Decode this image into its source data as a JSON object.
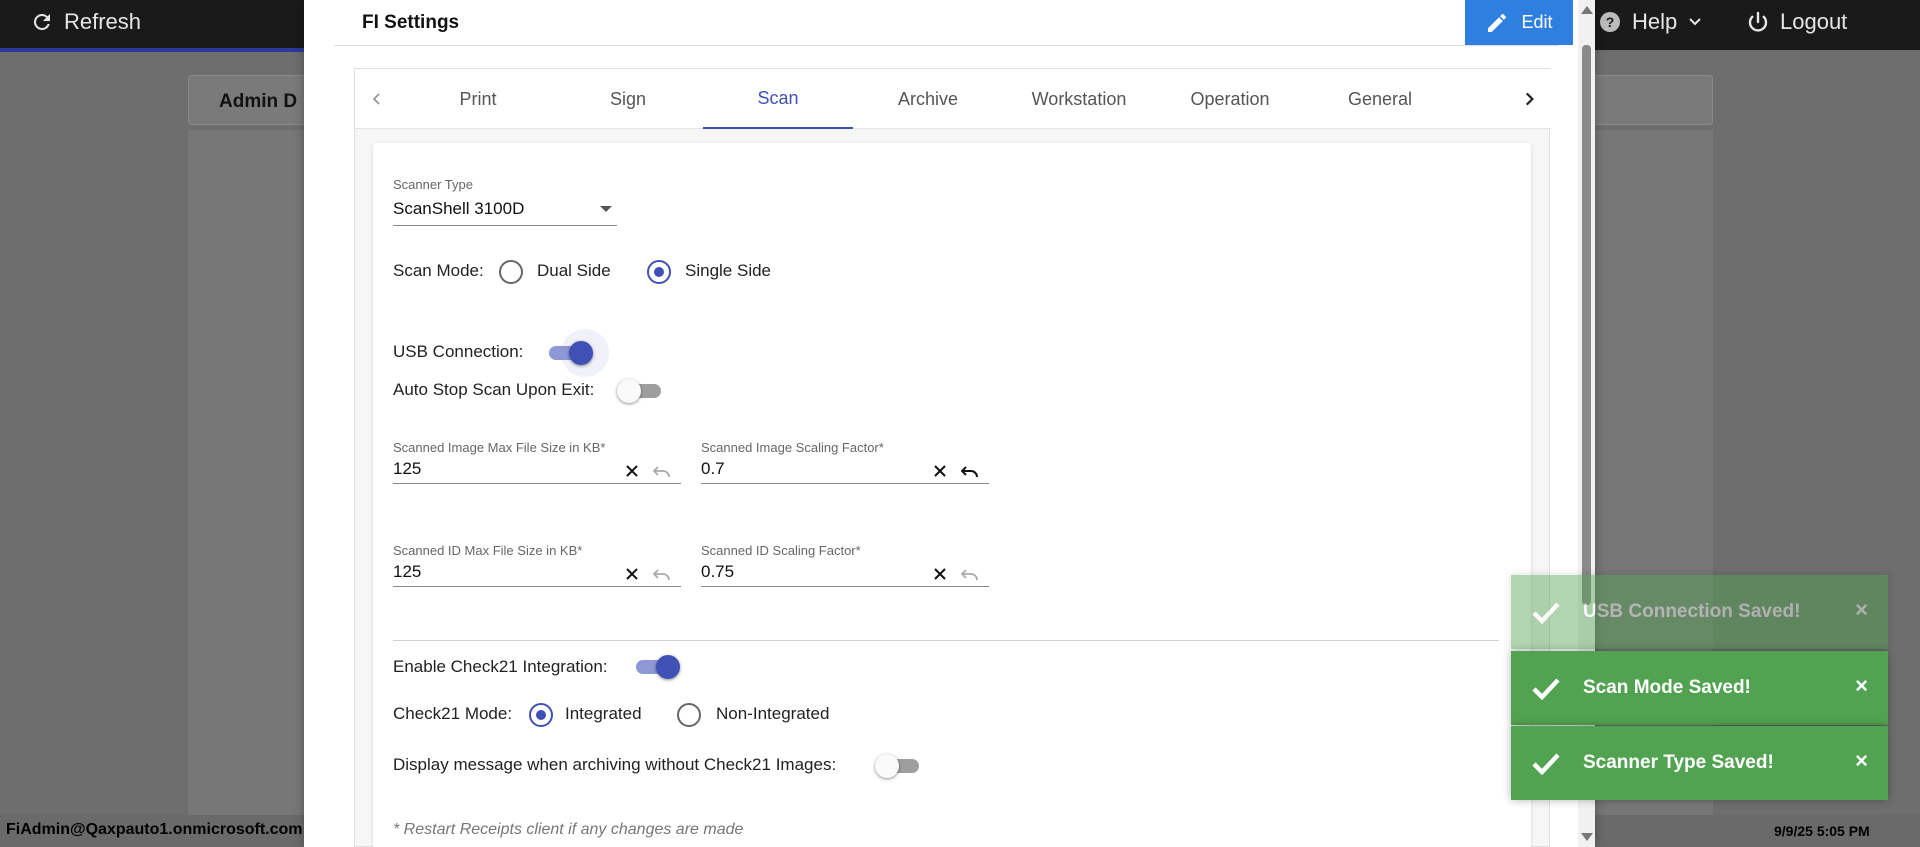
{
  "topbar": {
    "refresh_label": "Refresh",
    "help_label": "Help",
    "logout_label": "Logout"
  },
  "background": {
    "card_title": "Admin D",
    "user_email": "FiAdmin@Qaxpauto1.onmicrosoft.com",
    "datetime": "9/9/25 5:05 PM"
  },
  "modal": {
    "title": "FI Settings",
    "edit_label": "Edit",
    "tabs": [
      {
        "label": "Print"
      },
      {
        "label": "Sign"
      },
      {
        "label": "Scan"
      },
      {
        "label": "Archive"
      },
      {
        "label": "Workstation"
      },
      {
        "label": "Operation"
      },
      {
        "label": "General"
      }
    ],
    "active_tab": "Scan"
  },
  "scan": {
    "scanner_type_label": "Scanner Type",
    "scanner_type_value": "ScanShell 3100D",
    "scan_mode_label": "Scan Mode:",
    "scan_mode_options": [
      "Dual Side",
      "Single Side"
    ],
    "scan_mode_selected": "Single Side",
    "usb_label": "USB Connection:",
    "usb_on": true,
    "auto_stop_label": "Auto Stop Scan Upon Exit:",
    "auto_stop_on": false,
    "img_max_label": "Scanned Image Max File Size in KB*",
    "img_max_value": "125",
    "img_scale_label": "Scanned Image Scaling Factor*",
    "img_scale_value": "0.7",
    "id_max_label": "Scanned ID Max File Size in KB*",
    "id_max_value": "125",
    "id_scale_label": "Scanned ID Scaling Factor*",
    "id_scale_value": "0.75",
    "check21_label": "Enable Check21 Integration:",
    "check21_on": true,
    "check21_mode_label": "Check21 Mode:",
    "check21_mode_options": [
      "Integrated",
      "Non-Integrated"
    ],
    "check21_mode_selected": "Integrated",
    "archive_msg_label": "Display message when archiving without Check21 Images:",
    "archive_msg_on": false,
    "restart_note": "* Restart Receipts client if any changes are made"
  },
  "toasts": [
    {
      "message": "USB Connection Saved!",
      "close": "×"
    },
    {
      "message": "Scan Mode Saved!",
      "close": "×"
    },
    {
      "message": "Scanner Type Saved!",
      "close": "×"
    }
  ],
  "colors": {
    "accent": "#3f51b5",
    "edit_button": "#2e7fe0",
    "toast_success": "#51a351"
  }
}
